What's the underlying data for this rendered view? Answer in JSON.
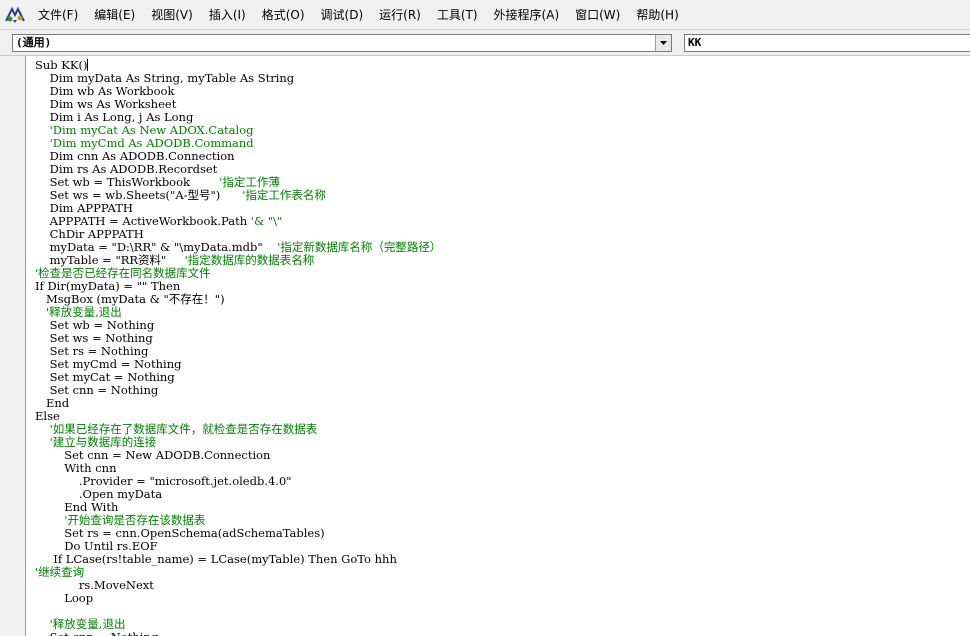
{
  "menu": {
    "items": [
      {
        "label": "文件(F)"
      },
      {
        "label": "编辑(E)"
      },
      {
        "label": "视图(V)"
      },
      {
        "label": "插入(I)"
      },
      {
        "label": "格式(O)"
      },
      {
        "label": "调试(D)"
      },
      {
        "label": "运行(R)"
      },
      {
        "label": "工具(T)"
      },
      {
        "label": "外接程序(A)"
      },
      {
        "label": "窗口(W)"
      },
      {
        "label": "帮助(H)"
      }
    ]
  },
  "object_selector": {
    "value": "(通用)"
  },
  "procedure_selector": {
    "value": "KK"
  },
  "code": [
    {
      "text": "Sub KK()",
      "comment": false,
      "caret": true
    },
    {
      "text": "    Dim myData As String, myTable As String",
      "comment": false
    },
    {
      "text": "    Dim wb As Workbook",
      "comment": false
    },
    {
      "text": "    Dim ws As Worksheet",
      "comment": false
    },
    {
      "text": "    Dim i As Long, j As Long",
      "comment": false
    },
    {
      "text": "    'Dim myCat As New ADOX.Catalog",
      "comment": true
    },
    {
      "text": "    'Dim myCmd As ADODB.Command",
      "comment": true
    },
    {
      "text": "    Dim cnn As ADODB.Connection",
      "comment": false
    },
    {
      "text": "    Dim rs As ADODB.Recordset",
      "comment": false
    },
    {
      "text": "    Set wb = ThisWorkbook        ",
      "comment": false,
      "comment_text": "'指定工作薄"
    },
    {
      "text": "    Set ws = wb.Sheets(\"A-型号\")      ",
      "comment": false,
      "comment_text": "'指定工作表名称"
    },
    {
      "text": "    Dim APPPATH",
      "comment": false
    },
    {
      "text": "    APPPATH = ActiveWorkbook.Path ",
      "comment": false,
      "comment_text": "'& \"\\\""
    },
    {
      "text": "    ChDir APPPATH",
      "comment": false
    },
    {
      "text": "    myData = \"D:\\RR\" & \"\\myData.mdb\"    ",
      "comment": false,
      "comment_text": "'指定新数据库名称（完整路径）"
    },
    {
      "text": "    myTable = \"RR资料\"     ",
      "comment": false,
      "comment_text": "'指定数据库的数据表名称"
    },
    {
      "text": "'检查是否已经存在同名数据库文件",
      "comment": true
    },
    {
      "text": "If Dir(myData) = \"\" Then",
      "comment": false
    },
    {
      "text": "   MsgBox (myData & \"不存在！\")",
      "comment": false
    },
    {
      "text": "   '释放变量,退出",
      "comment": true
    },
    {
      "text": "    Set wb = Nothing",
      "comment": false
    },
    {
      "text": "    Set ws = Nothing",
      "comment": false
    },
    {
      "text": "    Set rs = Nothing",
      "comment": false
    },
    {
      "text": "    Set myCmd = Nothing",
      "comment": false
    },
    {
      "text": "    Set myCat = Nothing",
      "comment": false
    },
    {
      "text": "    Set cnn = Nothing",
      "comment": false
    },
    {
      "text": "   End",
      "comment": false
    },
    {
      "text": "Else",
      "comment": false
    },
    {
      "text": "    '如果已经存在了数据库文件，就检查是否存在数据表",
      "comment": true
    },
    {
      "text": "    '建立与数据库的连接",
      "comment": true
    },
    {
      "text": "        Set cnn = New ADODB.Connection",
      "comment": false
    },
    {
      "text": "        With cnn",
      "comment": false
    },
    {
      "text": "            .Provider = \"microsoft.jet.oledb.4.0\"",
      "comment": false
    },
    {
      "text": "            .Open myData",
      "comment": false
    },
    {
      "text": "        End With",
      "comment": false
    },
    {
      "text": "        '开始查询是否存在该数据表",
      "comment": true
    },
    {
      "text": "        Set rs = cnn.OpenSchema(adSchemaTables)",
      "comment": false
    },
    {
      "text": "        Do Until rs.EOF",
      "comment": false
    },
    {
      "text": "     If LCase(rs!table_name) = LCase(myTable) Then GoTo hhh",
      "comment": false
    },
    {
      "text": "'继续查询",
      "comment": true
    },
    {
      "text": "            rs.MoveNext",
      "comment": false
    },
    {
      "text": "        Loop",
      "comment": false
    },
    {
      "text": "",
      "comment": false
    },
    {
      "text": "    '释放变量,退出",
      "comment": true
    },
    {
      "text": "    Set cnn = Nothing",
      "comment": false
    }
  ]
}
